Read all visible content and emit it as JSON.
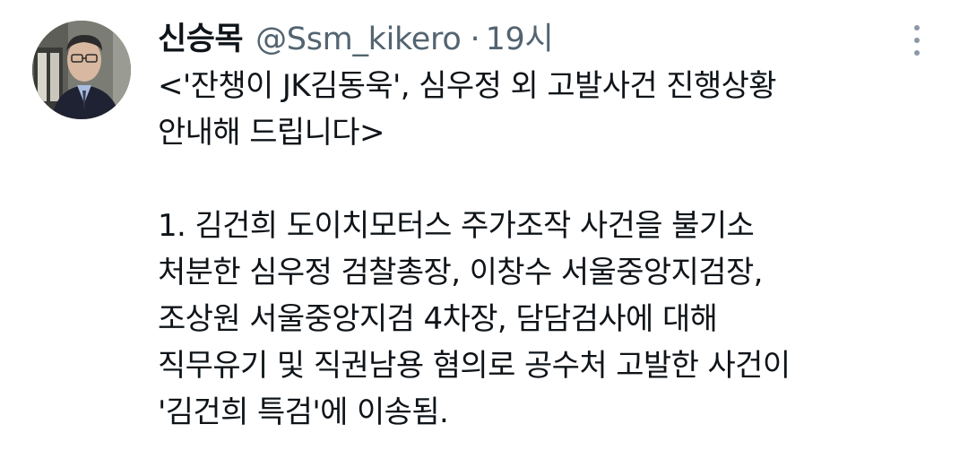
{
  "tweet": {
    "display_name": "신승목",
    "handle": "@Ssm_kikero",
    "separator": "·",
    "time": "19시",
    "more_icon": "more-vertical-icon",
    "lines_intro": [
      "<'잔챙이 JK김동욱', 심우정 외 고발사건 진행상황",
      "안내해 드립니다>"
    ],
    "lines_item1": [
      "1. 김건희 도이치모터스 주가조작 사건을 불기소",
      "처분한 심우정 검찰총장, 이창수 서울중앙지검장,",
      "조상원 서울중앙지검 4차장, 담담검사에 대해",
      "직무유기 및 직권남용 혐의로 공수처 고발한 사건이",
      "'김건희 특검'에 이송됨."
    ]
  },
  "colors": {
    "text_primary": "#0f1419",
    "text_secondary": "#536471",
    "background": "#ffffff"
  }
}
